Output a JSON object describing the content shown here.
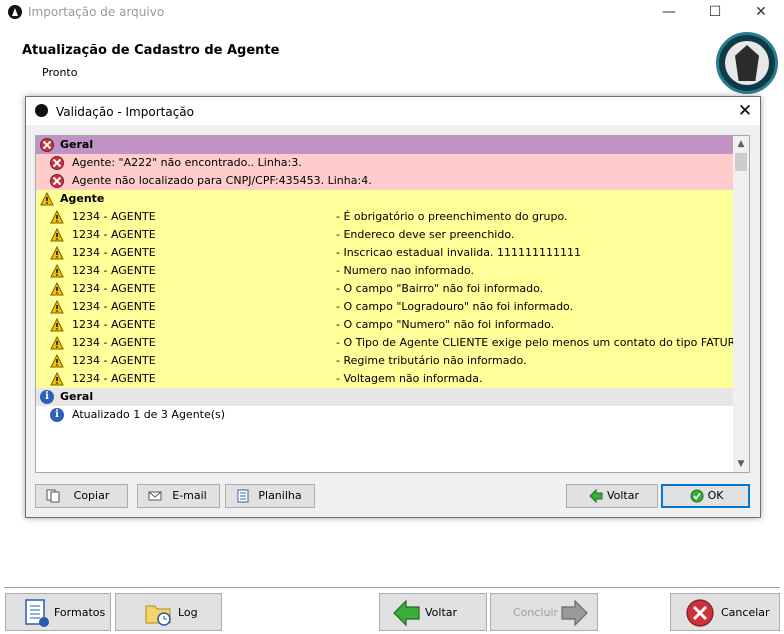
{
  "window": {
    "title": "Importação de arquivo",
    "minimize": "—",
    "maximize": "☐",
    "close": "✕"
  },
  "header": {
    "title": "Atualização de Cadastro de Agente",
    "status": "Pronto"
  },
  "dialog": {
    "title": "Validação - Importação",
    "close": "✕",
    "groups": [
      {
        "label": "Geral",
        "kind": "error",
        "color": "#c092c6",
        "rows": [
          {
            "text": "Agente: \"A222\" não encontrado.. Linha:3."
          },
          {
            "text": "Agente não localizado para CNPJ/CPF:435453. Linha:4."
          }
        ]
      },
      {
        "label": "Agente",
        "kind": "warning",
        "color": "#ffff99",
        "rows": [
          {
            "code": "1234 - AGENTE",
            "msg": "- É obrigatório o preenchimento do grupo."
          },
          {
            "code": "1234 - AGENTE",
            "msg": "- Endereco deve ser preenchido."
          },
          {
            "code": "1234 - AGENTE",
            "msg": "- Inscricao estadual invalida. 111111111111"
          },
          {
            "code": "1234 - AGENTE",
            "msg": "- Numero nao informado."
          },
          {
            "code": "1234 - AGENTE",
            "msg": "- O campo \"Bairro\" não foi informado."
          },
          {
            "code": "1234 - AGENTE",
            "msg": "- O campo \"Logradouro\" não foi informado."
          },
          {
            "code": "1234 - AGENTE",
            "msg": "- O campo \"Numero\" não foi informado."
          },
          {
            "code": "1234 -  AGENTE",
            "msg": "- O Tipo de Agente CLIENTE exige pelo menos um contato do tipo FATURAMENTO"
          },
          {
            "code": "1234 - AGENTE",
            "msg": "- Regime tributário não informado."
          },
          {
            "code": "1234 - AGENTE",
            "msg": "- Voltagem não informada."
          }
        ]
      },
      {
        "label": "Geral",
        "kind": "info",
        "color": "#e6e6e6",
        "rows": [
          {
            "text": "Atualizado 1 de 3 Agente(s)"
          }
        ]
      }
    ],
    "buttons": {
      "copiar": "Copiar",
      "email": "E-mail",
      "planilha": "Planilha",
      "voltar": "Voltar",
      "ok": "OK"
    }
  },
  "toolbar": {
    "formatos": "Formatos",
    "log": "Log",
    "voltar": "Voltar",
    "concluir": "Concluir",
    "cancelar": "Cancelar"
  },
  "colors": {
    "error_row": "#ffcccc",
    "warning_row": "#ffff99",
    "error_group": "#c092c6",
    "ok_border": "#0078d7"
  }
}
